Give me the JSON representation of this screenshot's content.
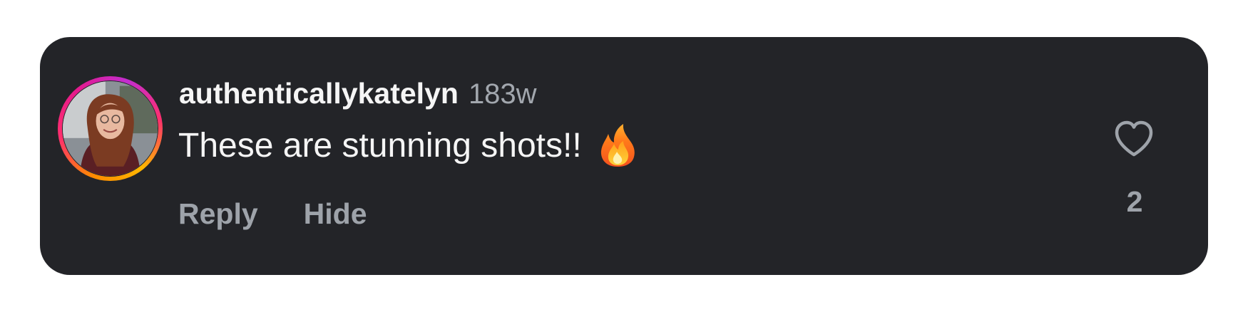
{
  "comment": {
    "username": "authenticallykatelyn",
    "timestamp": "183w",
    "text": "These are stunning shots!!",
    "emoji_icon": "fire-icon",
    "actions": {
      "reply_label": "Reply",
      "hide_label": "Hide"
    },
    "like": {
      "icon": "heart-outline-icon",
      "count": "2"
    }
  },
  "colors": {
    "card_background": "#232428",
    "primary_text": "#f5f5f5",
    "secondary_text": "#9ea3aa",
    "story_ring_start": "#ff8a00",
    "story_ring_end": "#c22ecf"
  }
}
